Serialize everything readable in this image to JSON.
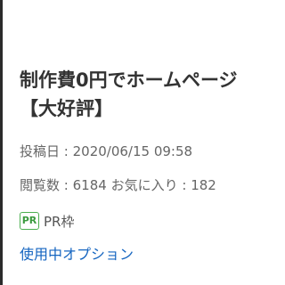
{
  "listing": {
    "title_line1": "制作費0円でホームページ",
    "title_line2": "【大好評】",
    "posted_label": "投稿日",
    "posted_value": "2020/06/15 09:58",
    "views_label": "閲覧数",
    "views_value": "6184",
    "favorites_label": "お気に入り",
    "favorites_value": "182"
  },
  "pr": {
    "badge": "PR",
    "label": "PR枠"
  },
  "options_link": "使用中オプション",
  "colors": {
    "pr_badge": "#4caf50",
    "link": "#1565c0"
  }
}
